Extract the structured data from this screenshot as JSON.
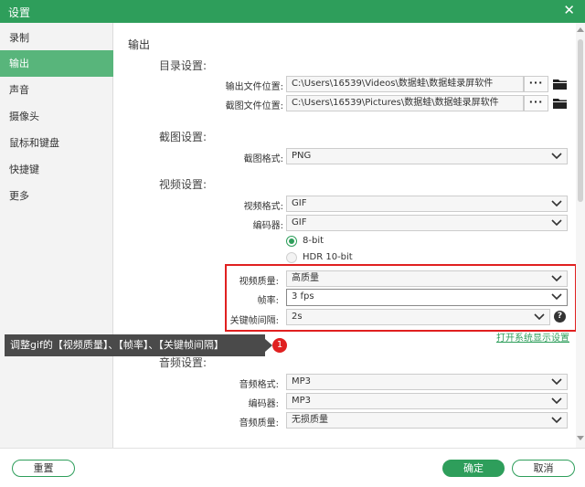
{
  "window": {
    "title": "设置",
    "close_glyph": "✕"
  },
  "sidebar": {
    "items": [
      {
        "label": "录制"
      },
      {
        "label": "输出",
        "active": true
      },
      {
        "label": "声音"
      },
      {
        "label": "摄像头"
      },
      {
        "label": "鼠标和键盘"
      },
      {
        "label": "快捷键"
      },
      {
        "label": "更多"
      }
    ]
  },
  "output": {
    "section_title": "输出",
    "dir_group": {
      "title": "目录设置:",
      "output_folder_label": "输出文件位置:",
      "output_folder_value": "C:\\Users\\16539\\Videos\\数据蛙\\数据蛙录屏软件",
      "screenshot_folder_label": "截图文件位置:",
      "screenshot_folder_value": "C:\\Users\\16539\\Pictures\\数据蛙\\数据蛙录屏软件",
      "browse_label": "···",
      "folder_icon": "folder-icon"
    },
    "screenshot_group": {
      "title": "截图设置:",
      "format_label": "截图格式:",
      "format_value": "PNG"
    },
    "video_group": {
      "title": "视频设置:",
      "format_label": "视频格式:",
      "format_value": "GIF",
      "encoder_label": "编码器:",
      "encoder_value": "GIF",
      "bit_depth_options": [
        {
          "label": "8-bit",
          "selected": true
        },
        {
          "label": "HDR 10-bit",
          "selected": false
        }
      ],
      "quality_label": "视频质量:",
      "quality_value": "高质量",
      "fps_label": "帧率:",
      "fps_value": "3 fps",
      "keyframe_label": "关键帧间隔:",
      "keyframe_value": "2s",
      "help_glyph": "?",
      "system_display_link": "打开系统显示设置"
    },
    "audio_group": {
      "title": "音频设置:",
      "format_label": "音频格式:",
      "format_value": "MP3",
      "encoder_label": "编码器:",
      "encoder_value": "MP3",
      "quality_label": "音频质量:",
      "quality_value": "无损质量"
    }
  },
  "annotation": {
    "tooltip_text": "调整gif的【视频质量】、【帧率】、【关键帧间隔】",
    "badge_number": "1",
    "highlight_color": "#e02020"
  },
  "footer": {
    "reset_label": "重置",
    "ok_label": "确定",
    "cancel_label": "取消"
  },
  "colors": {
    "accent": "#2e9e5b",
    "sidebar_active": "#58b57b"
  }
}
